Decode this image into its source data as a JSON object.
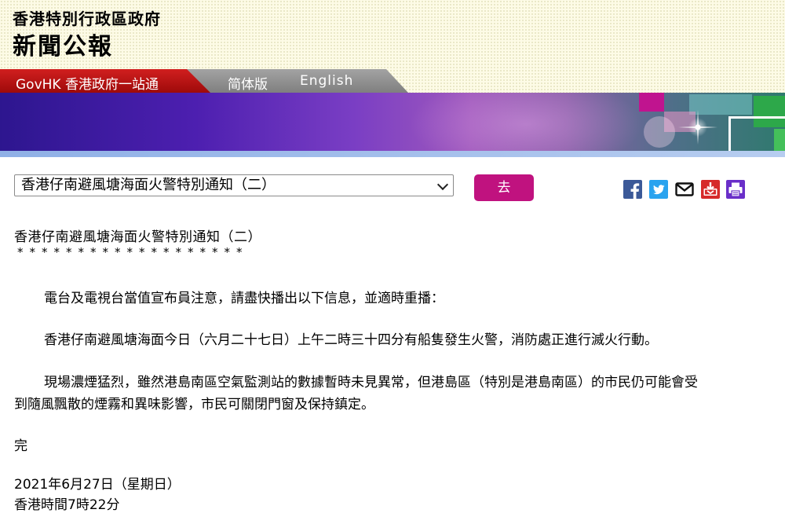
{
  "header": {
    "dept_title": "香港特別行政區政府",
    "site_title": "新聞公報"
  },
  "nav": {
    "govhk": "GovHK 香港政府一站通",
    "simplified": "简体版",
    "english": "English"
  },
  "selector": {
    "selected": "香港仔南避風塘海面火警特別通知（二）",
    "go_label": "去"
  },
  "share_icons": [
    "facebook-icon",
    "twitter-icon",
    "email-icon",
    "download-icon",
    "print-icon"
  ],
  "article": {
    "title": "香港仔南避風塘海面火警特別通知（二）",
    "stars": "*******************",
    "p1": "電台及電視台當值宣布員注意，請盡快播出以下信息，並適時重播：",
    "p2": "香港仔南避風塘海面今日（六月二十七日）上午二時三十四分有船隻發生火警，消防處正進行滅火行動。",
    "p3_line1": "現場濃煙猛烈，雖然港島南區空氣監測站的數據暫時未見異常，但港島區（特別是港島南區）的市民仍可能會受",
    "p3_line2": "到隨風飄散的煙霧和異味影響，市民可關閉門窗及保持鎮定。",
    "end": "完",
    "date": "2021年6月27日（星期日）",
    "time": "香港時間7時22分"
  },
  "colors": {
    "nav_red": "#b21414",
    "go_button": "#c0127f",
    "banner_purple": "#4d1fb0"
  }
}
